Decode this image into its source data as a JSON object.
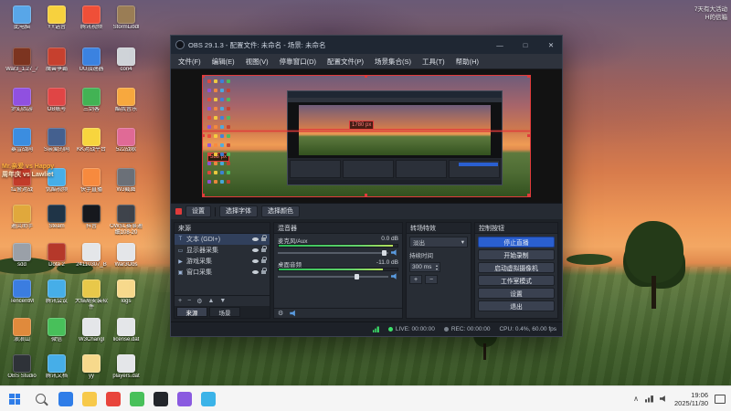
{
  "desktop": {
    "corner_note_line1": "7天有大活动",
    "corner_note_line2": "H的信箱",
    "overlay_line1": "Mr.亲爱 vs Happy",
    "overlay_line2": "周年庆 vs Lawliet",
    "icons": [
      {
        "label": "此电脑",
        "color": "#58a6e8",
        "col": 0,
        "row": 0
      },
      {
        "label": "YY语音",
        "color": "#f7d13e",
        "col": 1,
        "row": 0
      },
      {
        "label": "腾讯视频",
        "color": "#ef4f38",
        "col": 2,
        "row": 0
      },
      {
        "label": "StormLibdl",
        "color": "#9a7d55",
        "col": 3,
        "row": 0
      },
      {
        "label": "War3_1.27_7",
        "color": "#7c3420",
        "col": 0,
        "row": 1
      },
      {
        "label": "魔兽争霸",
        "color": "#c6402e",
        "col": 1,
        "row": 1
      },
      {
        "label": "UU加速器",
        "color": "#3b82e0",
        "col": 2,
        "row": 1
      },
      {
        "label": "con4",
        "color": "#cfd3d8",
        "col": 3,
        "row": 1
      },
      {
        "label": "梦幻西游",
        "color": "#9050e0",
        "col": 0,
        "row": 2
      },
      {
        "label": "OB账号",
        "color": "#e04545",
        "col": 1,
        "row": 2
      },
      {
        "label": "三剑客",
        "color": "#42b354",
        "col": 2,
        "row": 2
      },
      {
        "label": "酷我音乐",
        "color": "#f7a83e",
        "col": 3,
        "row": 2
      },
      {
        "label": "暴雪战网",
        "color": "#3b8de0",
        "col": 0,
        "row": 3
      },
      {
        "label": "S亲爱的网",
        "color": "#44608f",
        "col": 1,
        "row": 3
      },
      {
        "label": "KK对战平台",
        "color": "#f7d53e",
        "col": 2,
        "row": 3
      },
      {
        "label": "522战歌",
        "color": "#e06a96",
        "col": 3,
        "row": 3
      },
      {
        "label": "红警对战",
        "color": "#c23b2a",
        "col": 0,
        "row": 4
      },
      {
        "label": "优酷视频",
        "color": "#46aee8",
        "col": 1,
        "row": 4
      },
      {
        "label": "快手直播",
        "color": "#f78a3e",
        "col": 2,
        "row": 4
      },
      {
        "label": "W3截图",
        "color": "#6b7078",
        "col": 3,
        "row": 4
      },
      {
        "label": "通灵助手",
        "color": "#e0a83c",
        "col": 0,
        "row": 5
      },
      {
        "label": "Steam",
        "color": "#1f3447",
        "col": 1,
        "row": 5
      },
      {
        "label": "抖音",
        "color": "#16181d",
        "col": 2,
        "row": 5
      },
      {
        "label": "OWSL赛事通 细108-20",
        "color": "#3e434b",
        "col": 3,
        "row": 5
      },
      {
        "label": "sdd",
        "color": "#9aa0a8",
        "col": 0,
        "row": 6
      },
      {
        "label": "Dota 2",
        "color": "#b5382a",
        "col": 1,
        "row": 6
      },
      {
        "label": "24110307_B",
        "color": "#e4e6e9",
        "col": 2,
        "row": 6
      },
      {
        "label": "War3Obs",
        "color": "#e4e6e9",
        "col": 3,
        "row": 6
      },
      {
        "label": "TencentM",
        "color": "#3b7de0",
        "col": 0,
        "row": 7
      },
      {
        "label": "腾讯会议",
        "color": "#46aee8",
        "col": 1,
        "row": 7
      },
      {
        "label": "大结局安装软件",
        "color": "#e8c84a",
        "col": 2,
        "row": 7
      },
      {
        "label": "logs",
        "color": "#f7d98c",
        "col": 3,
        "row": 7
      },
      {
        "label": "浪浪山",
        "color": "#e08a3c",
        "col": 0,
        "row": 8
      },
      {
        "label": "微信",
        "color": "#48c05a",
        "col": 1,
        "row": 8
      },
      {
        "label": "W3Changl",
        "color": "#e4e6e9",
        "col": 2,
        "row": 8
      },
      {
        "label": "license.dat",
        "color": "#e4e6e9",
        "col": 3,
        "row": 8
      },
      {
        "label": "OBS Studio",
        "color": "#2e3238",
        "col": 0,
        "row": 9
      },
      {
        "label": "腾讯文档",
        "color": "#46aee8",
        "col": 1,
        "row": 9
      },
      {
        "label": "yy",
        "color": "#f7d98c",
        "col": 2,
        "row": 9
      },
      {
        "label": "players.dat",
        "color": "#e4e6e9",
        "col": 3,
        "row": 9
      }
    ]
  },
  "obs": {
    "title": "OBS 29.1.3 - 配置文件: 未命名 - 场景: 未命名",
    "window_controls": {
      "min": "—",
      "max": "□",
      "close": "✕"
    },
    "menu": [
      "文件(F)",
      "编辑(E)",
      "视图(V)",
      "停靠窗口(D)",
      "配置文件(P)",
      "场景集合(S)",
      "工具(T)",
      "帮助(H)"
    ],
    "preview": {
      "width_label": "1780 px",
      "height_label": "588 px"
    },
    "source_toolbar": {
      "settings": "设置",
      "font": "选择字体",
      "color": "选择颜色"
    },
    "sources": {
      "title": "来源",
      "items": [
        {
          "label": "文本 (GDI+)",
          "glyph": "T",
          "selected": true
        },
        {
          "label": "显示器采集",
          "glyph": "▭",
          "selected": false
        },
        {
          "label": "游戏采集",
          "glyph": "▶",
          "selected": false
        },
        {
          "label": "窗口采集",
          "glyph": "▣",
          "selected": false
        }
      ],
      "tabs": [
        {
          "label": "来源",
          "active": true
        },
        {
          "label": "场景",
          "active": false
        }
      ]
    },
    "mixer": {
      "title": "混音器",
      "channels": [
        {
          "name": "麦克风/Aux",
          "db": "0.0 dB",
          "level": 0.96,
          "slider": 0.97
        },
        {
          "name": "桌面音频",
          "db": "-11.0 dB",
          "level": 0.88,
          "slider": 0.72
        }
      ]
    },
    "transitions": {
      "title": "转场特效",
      "selected": "淡出",
      "duration_label": "持续时间",
      "duration_value": "300 ms"
    },
    "controls": {
      "title": "控制按钮",
      "buttons": [
        {
          "label": "停止直播",
          "primary": true
        },
        {
          "label": "开始录制",
          "primary": false
        },
        {
          "label": "启动虚拟摄像机",
          "primary": false
        },
        {
          "label": "工作室模式",
          "primary": false
        },
        {
          "label": "设置",
          "primary": false
        },
        {
          "label": "退出",
          "primary": false
        }
      ]
    },
    "status": {
      "live": "LIVE: 00:00:00",
      "rec": "REC: 00:00:00",
      "stats": "CPU: 0.4%, 60.00 fps"
    }
  },
  "taskbar": {
    "time": "19:06",
    "date": "2025/11/30",
    "apps": [
      {
        "name": "edge",
        "color": "#2f7de8"
      },
      {
        "name": "file-explorer",
        "color": "#f7c94a"
      },
      {
        "name": "chrome",
        "color": "#e8453c"
      },
      {
        "name": "wechat",
        "color": "#48c05a"
      },
      {
        "name": "obs",
        "color": "#23262b"
      },
      {
        "name": "game",
        "color": "#8a5ae0"
      },
      {
        "name": "browser",
        "color": "#3bb3e8"
      }
    ]
  }
}
